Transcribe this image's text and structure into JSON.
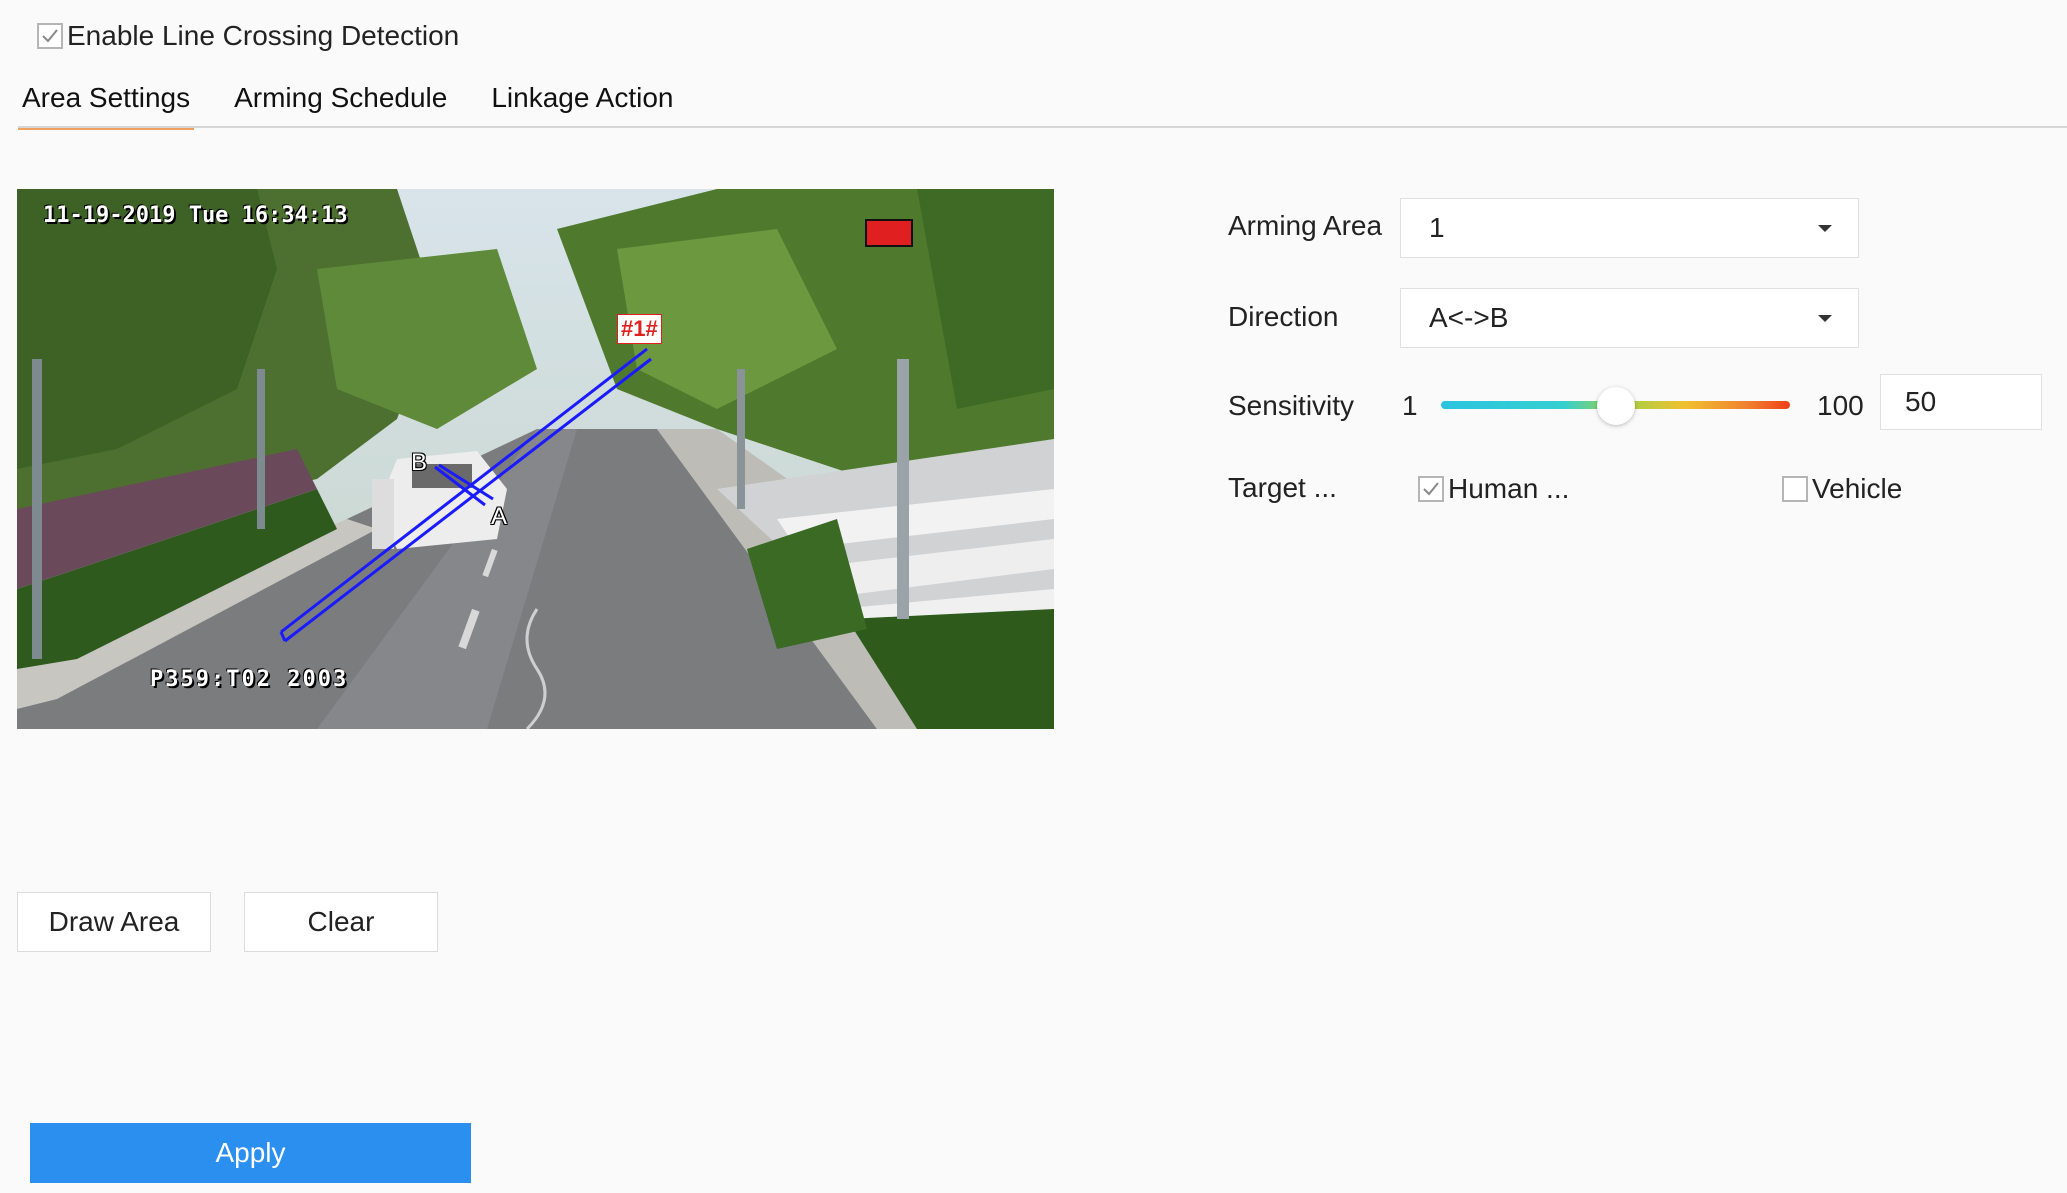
{
  "enable": {
    "label": "Enable Line Crossing Detection",
    "checked": true
  },
  "tabs": [
    {
      "label": "Area Settings",
      "active": true
    },
    {
      "label": "Arming Schedule",
      "active": false
    },
    {
      "label": "Linkage Action",
      "active": false
    }
  ],
  "preview": {
    "timestamp": "11-19-2019 Tue 16:34:13",
    "plate_text": "P359:T02  2003",
    "line_id": "#1#",
    "point_a": "A",
    "point_b": "B"
  },
  "form": {
    "arming_area": {
      "label": "Arming Area",
      "value": "1"
    },
    "direction": {
      "label": "Direction",
      "value": "A<->B"
    },
    "sensitivity": {
      "label": "Sensitivity",
      "min": "1",
      "max": "100",
      "value": "50",
      "fraction": 0.5
    },
    "target": {
      "label": "Target ...",
      "options": [
        {
          "label": "Human ...",
          "checked": true
        },
        {
          "label": "Vehicle",
          "checked": false
        }
      ]
    }
  },
  "buttons": {
    "draw_area": "Draw Area",
    "clear": "Clear",
    "apply": "Apply"
  },
  "colors": {
    "accent": "#2b8ff0",
    "tab_underline": "#f0a060",
    "line": "#1a1aff"
  }
}
